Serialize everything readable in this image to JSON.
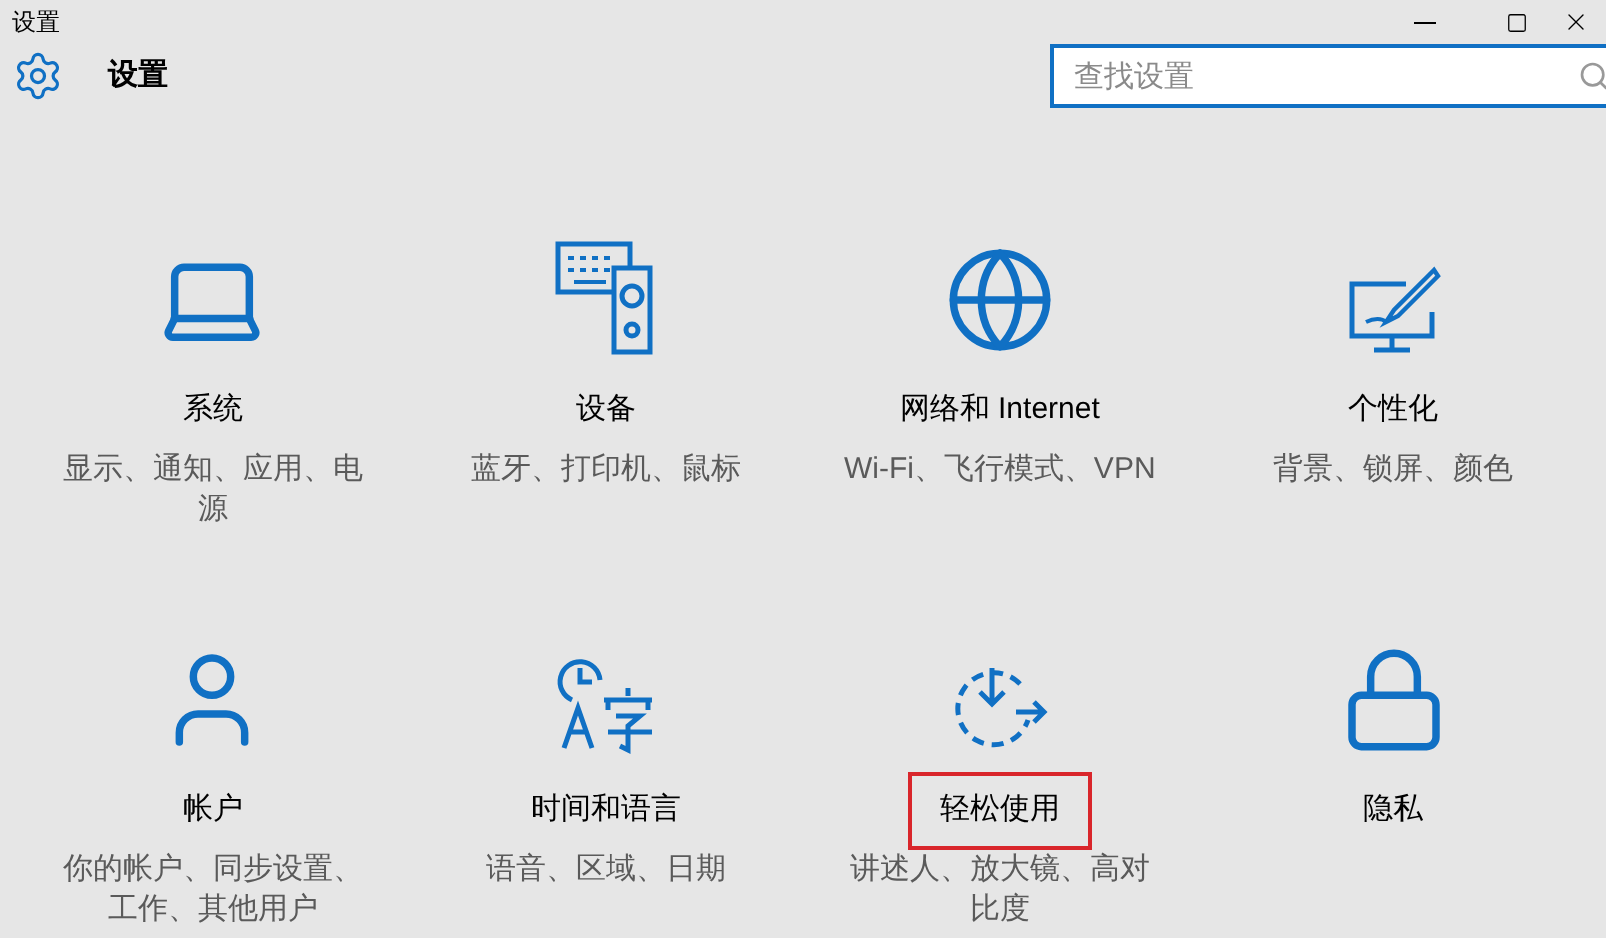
{
  "window": {
    "title": "设置"
  },
  "header": {
    "title": "设置"
  },
  "search": {
    "placeholder": "查找设置"
  },
  "tiles": [
    {
      "title": "系统",
      "description": "显示、通知、应用、电源",
      "highlighted": false
    },
    {
      "title": "设备",
      "description": "蓝牙、打印机、鼠标",
      "highlighted": false
    },
    {
      "title": "网络和 Internet",
      "description": "Wi-Fi、飞行模式、VPN",
      "highlighted": false
    },
    {
      "title": "个性化",
      "description": "背景、锁屏、颜色",
      "highlighted": false
    },
    {
      "title": "帐户",
      "description": "你的帐户、同步设置、工作、其他用户",
      "highlighted": false
    },
    {
      "title": "时间和语言",
      "description": "语音、区域、日期",
      "highlighted": false
    },
    {
      "title": "轻松使用",
      "description": "讲述人、放大镜、高对比度",
      "highlighted": true
    },
    {
      "title": "隐私",
      "highlighted": false
    }
  ]
}
